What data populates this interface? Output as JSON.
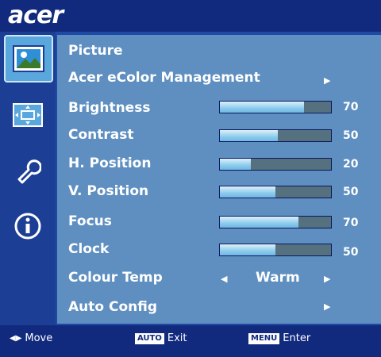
{
  "brand": "acer",
  "menu": {
    "section_title": "Picture",
    "ecolor_label": "Acer eColor Management",
    "items": [
      {
        "label": "Brightness",
        "value": "70",
        "level": 0.76
      },
      {
        "label": "Contrast",
        "value": "50",
        "level": 0.52
      },
      {
        "label": "H. Position",
        "value": "20",
        "level": 0.28
      },
      {
        "label": "V. Position",
        "value": "50",
        "level": 0.5
      },
      {
        "label": "Focus",
        "value": "70",
        "level": 0.71
      },
      {
        "label": "Clock",
        "value": "50",
        "level": 0.5
      }
    ],
    "colour_temp_label": "Colour Temp",
    "colour_temp_value": "Warm",
    "auto_config_label": "Auto Config"
  },
  "sidebar": {
    "icons": [
      "picture-icon",
      "position-icon",
      "settings-wrench-icon",
      "info-icon"
    ]
  },
  "footer": {
    "move_label": "Move",
    "auto_key": "AUTO",
    "exit_label": "Exit",
    "menu_key": "MENU",
    "enter_label": "Enter"
  }
}
